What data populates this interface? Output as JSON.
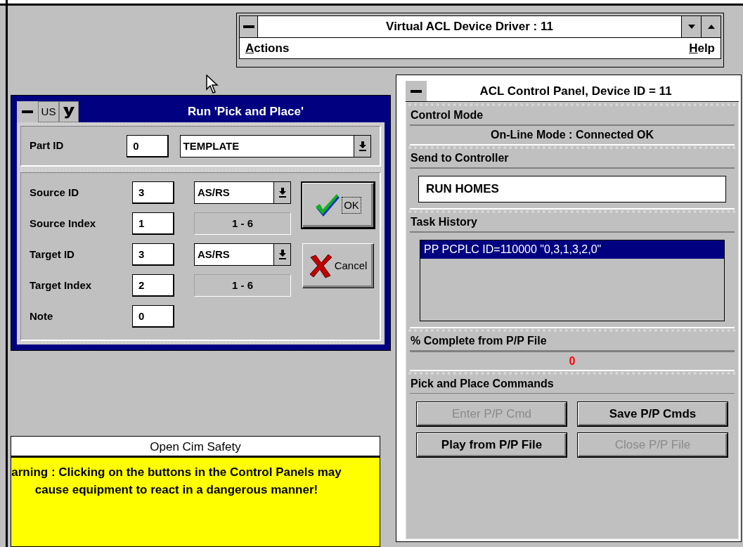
{
  "driver_window": {
    "title": "Virtual ACL Device Driver : 11",
    "menu": [
      {
        "label": "Actions"
      },
      {
        "label": "Help"
      }
    ]
  },
  "pick_window": {
    "title": "Run 'Pick and Place'",
    "toolbar": [
      "US"
    ],
    "part": {
      "label": "Part ID",
      "value": "0",
      "combo": "TEMPLATE"
    },
    "rows": [
      {
        "label": "Source ID",
        "value": "3",
        "kind": "combo",
        "extra": "AS/RS"
      },
      {
        "label": "Source Index",
        "value": "1",
        "kind": "range",
        "extra": "1 - 6"
      },
      {
        "label": "Target ID",
        "value": "3",
        "kind": "combo",
        "extra": "AS/RS"
      },
      {
        "label": "Target Index",
        "value": "2",
        "kind": "range",
        "extra": "1 - 6"
      },
      {
        "label": "Note",
        "value": "0"
      }
    ],
    "buttons": [
      {
        "kind": "ok",
        "label": "OK",
        "focused": true
      },
      {
        "kind": "cancel",
        "label": "Cancel",
        "focused": false
      }
    ]
  },
  "control_panel": {
    "title": "ACL Control Panel, Device ID = 11",
    "control_mode": {
      "heading": "Control Mode",
      "value": "On-Line Mode : Connected OK"
    },
    "send": {
      "heading": "Send to Controller",
      "value": "RUN HOMES"
    },
    "history": {
      "heading": "Task History",
      "items": [
        {
          "text": "PP PCPLC ID=110000 \"0,3,1,3,2,0\"",
          "selected": true
        }
      ]
    },
    "complete": {
      "heading": "% Complete from P/P File",
      "value": "0"
    },
    "commands": {
      "heading": "Pick and Place Commands",
      "buttons": [
        {
          "label": "Enter P/P Cmd",
          "disabled": true
        },
        {
          "label": "Save P/P Cmds",
          "disabled": false
        },
        {
          "label": "Play from P/P File",
          "disabled": false
        },
        {
          "label": "Close P/P File",
          "disabled": true
        }
      ]
    }
  },
  "safety_window": {
    "title": "Open Cim Safety",
    "message": "arning : Clicking on the buttons in the Control Panels may cause equipment to react in a dangerous manner!"
  }
}
